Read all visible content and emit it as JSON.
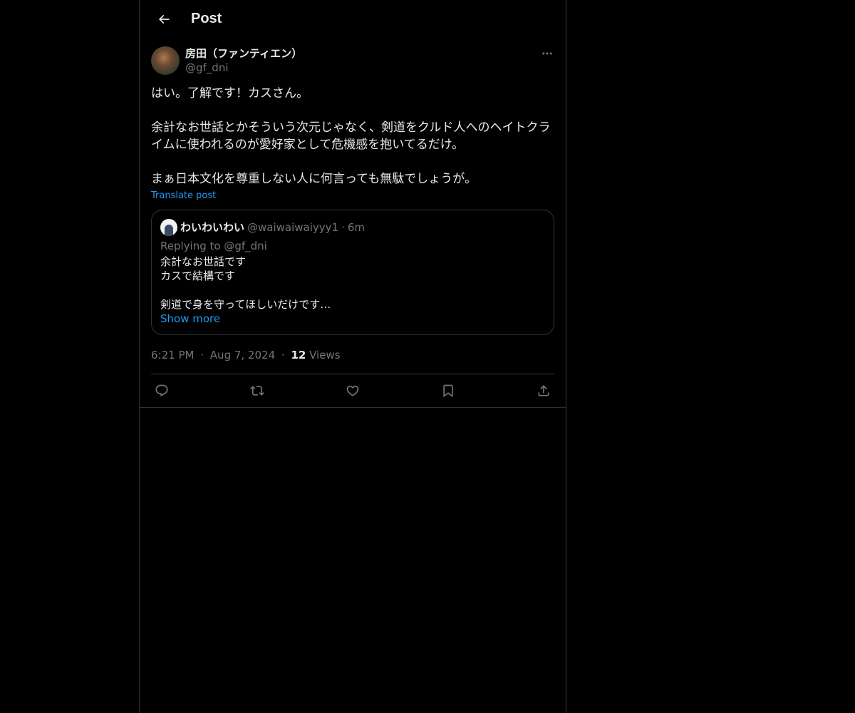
{
  "header": {
    "title": "Post",
    "back_icon": "arrow-left-icon"
  },
  "post": {
    "author": {
      "display_name": "房田（ファンティエン）",
      "handle": "@gf_dni"
    },
    "text": "はい。了解です！カスさん。\n\n余計なお世話とかそういう次元じゃなく、剣道をクルド人へのヘイトクライムに使われるのが愛好家として危機感を抱いてるだけ。\n\nまぁ日本文化を尊重しない人に何言っても無駄でしょうが。",
    "translate_label": "Translate post",
    "quote": {
      "display_name": "わいわいわい",
      "handle": "@waiwaiwaiyyy1",
      "separator": "·",
      "time": "6m",
      "replying_prefix": "Replying to",
      "replying_handle": "@gf_dni",
      "text": "余計なお世話です\nカスで結構です\n\n剣道で身を守ってほしいだけです…",
      "show_more": "Show more"
    },
    "meta": {
      "time": "6:21 PM",
      "separator": "·",
      "date": "Aug 7, 2024",
      "views_count": "12",
      "views_label": "Views"
    },
    "actions": {
      "reply_icon": "reply-icon",
      "repost_icon": "repost-icon",
      "like_icon": "heart-icon",
      "bookmark_icon": "bookmark-icon",
      "share_icon": "share-icon"
    }
  },
  "colors": {
    "background": "#000000",
    "text": "#e7e9ea",
    "muted": "#71767b",
    "accent": "#1d9bf0",
    "border": "#2f3336"
  }
}
